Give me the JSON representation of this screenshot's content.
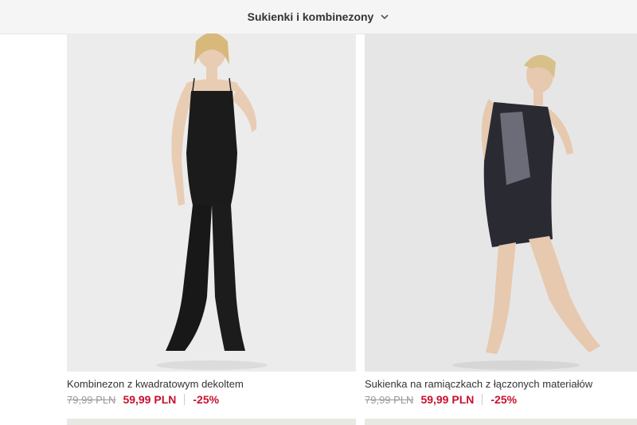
{
  "header": {
    "category_label": "Sukienki i kombinezony"
  },
  "products": [
    {
      "name": "Kombinezon z kwadratowym dekoltem",
      "old_price": "79,99 PLN",
      "new_price": "59,99 PLN",
      "discount": "-25%"
    },
    {
      "name": "Sukienka na ramiączkach z łączonych materiałów",
      "old_price": "79,99 PLN",
      "new_price": "59,99 PLN",
      "discount": "-25%"
    }
  ],
  "colors": {
    "sale": "#c8102e",
    "old_price": "#999999",
    "header_bg": "#f5f5f5"
  },
  "icons": {
    "dropdown": "chevron-down-icon"
  }
}
